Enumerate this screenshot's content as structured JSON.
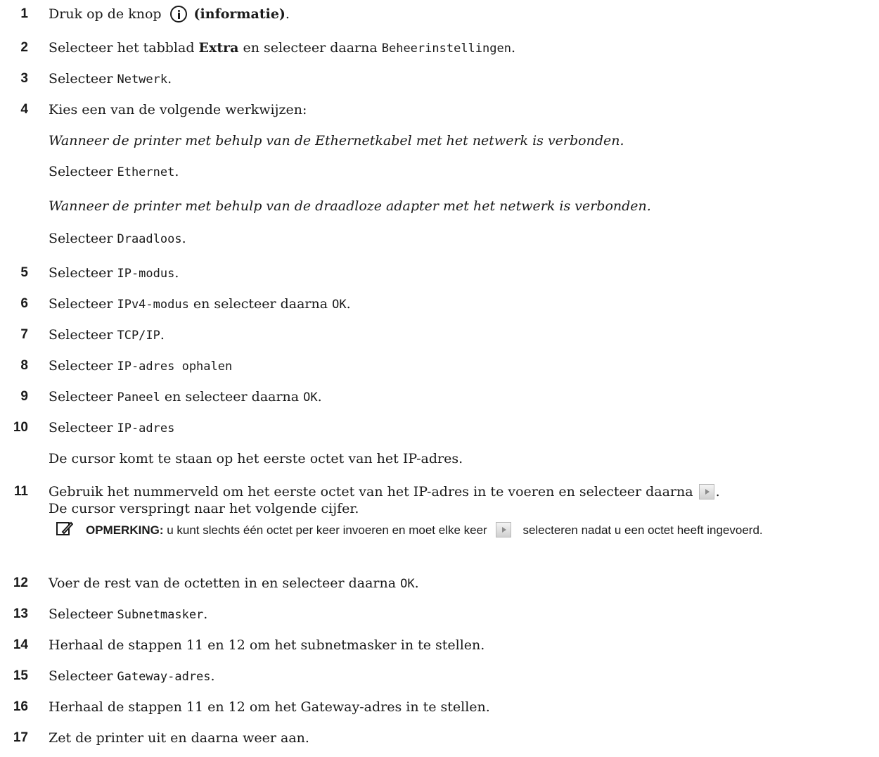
{
  "steps": {
    "s1": {
      "num": "1",
      "a": "Druk op de knop",
      "b": "(informatie)",
      "c": "."
    },
    "s2": {
      "num": "2",
      "a": "Selecteer het tabblad ",
      "b": "Extra",
      "c": " en selecteer daarna ",
      "d": "Beheerinstellingen",
      "e": "."
    },
    "s3": {
      "num": "3",
      "a": "Selecteer ",
      "b": "Netwerk",
      "c": "."
    },
    "s4": {
      "num": "4",
      "a": "Kies een van de volgende werkwijzen:"
    },
    "s4a": {
      "a": "Wanneer de printer met behulp van de Ethernetkabel met het netwerk is verbonden."
    },
    "s4b": {
      "a": "Selecteer ",
      "b": "Ethernet",
      "c": "."
    },
    "s4c": {
      "a": "Wanneer de printer met behulp van de draadloze adapter met het netwerk is verbonden."
    },
    "s4d": {
      "a": "Selecteer ",
      "b": "Draadloos",
      "c": "."
    },
    "s5": {
      "num": "5",
      "a": "Selecteer ",
      "b": "IP-modus",
      "c": "."
    },
    "s6": {
      "num": "6",
      "a": "Selecteer ",
      "b": "IPv4-modus",
      "c": " en selecteer daarna ",
      "d": "OK",
      "e": "."
    },
    "s7": {
      "num": "7",
      "a": "Selecteer ",
      "b": "TCP/IP",
      "c": "."
    },
    "s8": {
      "num": "8",
      "a": "Selecteer ",
      "b": "IP-adres ophalen"
    },
    "s9": {
      "num": "9",
      "a": "Selecteer ",
      "b": "Paneel",
      "c": " en selecteer daarna ",
      "d": "OK",
      "e": "."
    },
    "s10": {
      "num": "10",
      "a": "Selecteer ",
      "b": "IP-adres"
    },
    "s10b": {
      "a": "De cursor komt te staan op het eerste octet van het IP-adres."
    },
    "s11": {
      "num": "11",
      "a": "Gebruik het nummerveld om het eerste octet van het IP-adres in te voeren en selecteer daarna",
      "c": "."
    },
    "s11b": {
      "a": "De cursor verspringt naar het volgende cijfer."
    },
    "note": {
      "label": "OPMERKING:",
      "a": " u kunt slechts één octet per keer invoeren en moet elke keer",
      "b": " selecteren nadat u een octet heeft ingevoerd."
    },
    "s12": {
      "num": "12",
      "a": "Voer de rest van de octetten in en selecteer daarna ",
      "b": "OK",
      "c": "."
    },
    "s13": {
      "num": "13",
      "a": "Selecteer ",
      "b": "Subnetmasker",
      "c": "."
    },
    "s14": {
      "num": "14",
      "a": "Herhaal de stappen 11 en 12 om het subnetmasker in te stellen."
    },
    "s15": {
      "num": "15",
      "a": "Selecteer ",
      "b": "Gateway-adres",
      "c": "."
    },
    "s16": {
      "num": "16",
      "a": "Herhaal de stappen 11 en 12 om het Gateway-adres in te stellen."
    },
    "s17": {
      "num": "17",
      "a": "Zet de printer uit en daarna weer aan."
    }
  },
  "icons": {
    "info": "info-icon",
    "arrow": "right-arrow-button-icon",
    "note": "note-pencil-icon"
  }
}
